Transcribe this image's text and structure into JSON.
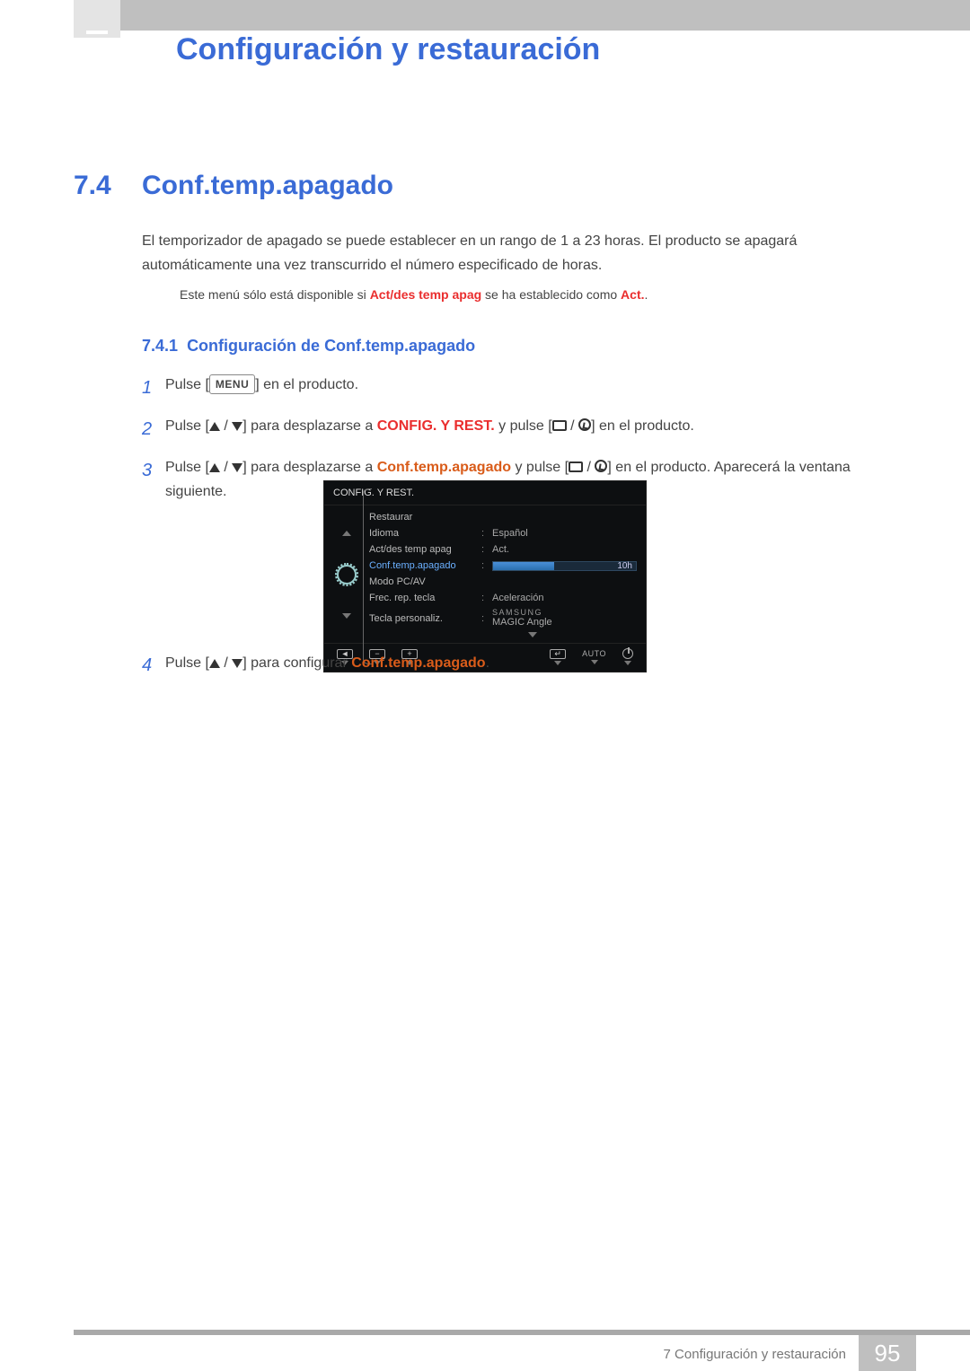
{
  "chapter_title": "Configuración y restauración",
  "section_number": "7.4",
  "section_title": "Conf.temp.apagado",
  "intro_text": "El temporizador de apagado se puede establecer en un rango de 1 a 23 horas. El producto se apagará automáticamente una vez transcurrido el número especificado de horas.",
  "note": {
    "prefix": "Este menú sólo está disponible si ",
    "em1": "Act/des temp apag",
    "mid": " se ha establecido como ",
    "em2": "Act.",
    "suffix": "."
  },
  "subsection_number": "7.4.1",
  "subsection_title": "Configuración de Conf.temp.apagado",
  "steps": {
    "s1": {
      "num": "1",
      "a": "Pulse [",
      "menu": "MENU",
      "b": "] en el producto."
    },
    "s2": {
      "num": "2",
      "a": "Pulse [",
      "b": "] para desplazarse a ",
      "target": "CONFIG. Y REST.",
      "c": " y pulse [",
      "d": "] en el producto."
    },
    "s3": {
      "num": "3",
      "a": "Pulse [",
      "b": "] para desplazarse a ",
      "target": "Conf.temp.apagado",
      "c": " y pulse [",
      "d": "] en el producto. Aparecerá la ventana siguiente."
    },
    "s4": {
      "num": "4",
      "a": "Pulse [",
      "b": "] para configurar ",
      "target": "Conf.temp.apagado",
      "c": "."
    }
  },
  "osd": {
    "title": "CONFIG. Y REST.",
    "rows": [
      {
        "label": "Restaurar",
        "value": ""
      },
      {
        "label": "Idioma",
        "value": "Español"
      },
      {
        "label": "Act/des temp apag",
        "value": "Act."
      },
      {
        "label": "Conf.temp.apagado",
        "value": "10h",
        "selected": true,
        "slider_pct": 43
      },
      {
        "label": "Modo PC/AV",
        "value": ""
      },
      {
        "label": "Frec. rep. tecla",
        "value": "Aceleración"
      },
      {
        "label": "Tecla personaliz.",
        "value_top": "SAMSUNG",
        "value": "MAGIC Angle"
      }
    ],
    "footer_auto": "AUTO"
  },
  "footer": {
    "text": "7 Configuración y restauración",
    "page": "95"
  }
}
